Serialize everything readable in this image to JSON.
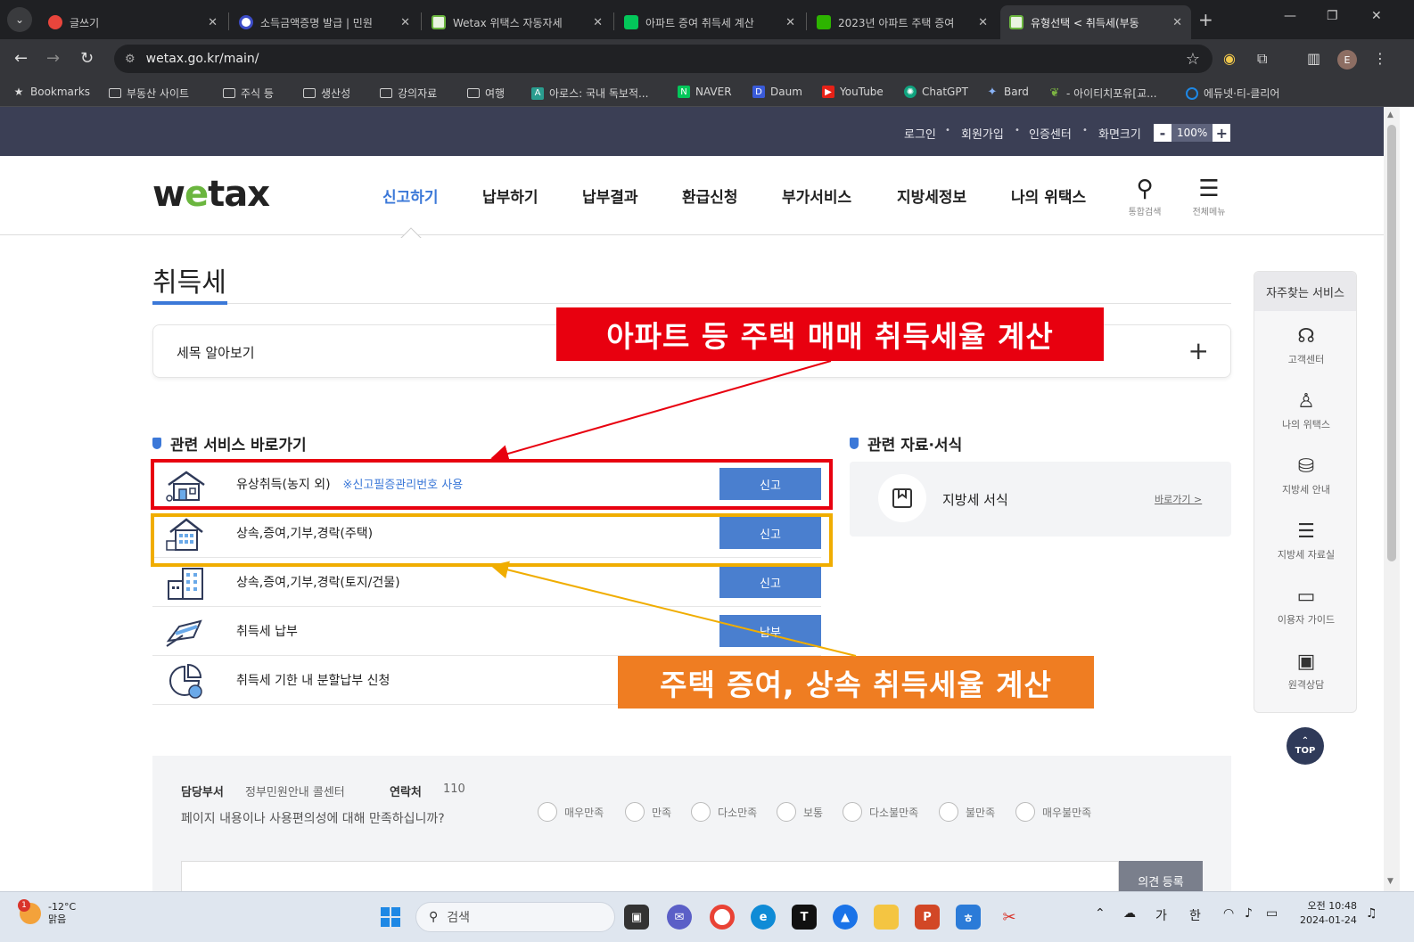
{
  "browser": {
    "tabs": [
      {
        "title": "글쓰기",
        "color": "#e8453c"
      },
      {
        "title": "소득금액증명 발급 | 민원",
        "color": "#3c4cc7"
      },
      {
        "title": "Wetax 위택스 자동자세",
        "color": "#6bb63f"
      },
      {
        "title": "아파트 증여 취득세 계산",
        "color": "#03c75a"
      },
      {
        "title": "2023년 아파트 주택 증여",
        "color": "#2db400"
      },
      {
        "title": "유형선택 < 취득세(부동",
        "color": "#6bb63f"
      }
    ],
    "url": "wetax.go.kr/main/",
    "bookmarks": [
      {
        "label": "Bookmarks",
        "kind": "star-icon"
      },
      {
        "label": "부동산 사이트",
        "kind": "folder-icon"
      },
      {
        "label": "주식 등",
        "kind": "folder-icon"
      },
      {
        "label": "생산성",
        "kind": "folder-icon"
      },
      {
        "label": "강의자료",
        "kind": "folder-icon"
      },
      {
        "label": "여행",
        "kind": "folder-icon"
      },
      {
        "label": "아로스: 국내 독보적...",
        "kind": "site-icon",
        "color": "#2a9d8f"
      },
      {
        "label": "NAVER",
        "kind": "site-icon",
        "color": "#03c75a"
      },
      {
        "label": "Daum",
        "kind": "site-icon",
        "color": "#3a5bd9"
      },
      {
        "label": "YouTube",
        "kind": "site-icon",
        "color": "#e62117"
      },
      {
        "label": "ChatGPT",
        "kind": "site-icon",
        "color": "#10a37f"
      },
      {
        "label": "Bard",
        "kind": "site-icon",
        "color": "#8ab4f8"
      },
      {
        "label": "- 아이티치포유[교...",
        "kind": "site-icon",
        "color": "#7cb342"
      },
      {
        "label": "에듀넷·티-클리어",
        "kind": "site-icon",
        "color": "#1e88e5"
      }
    ],
    "profile_initial": "E"
  },
  "util": {
    "login": "로그인",
    "signup": "회원가입",
    "cert": "인증센터",
    "screen": "화면크기",
    "zoom_minus": "-",
    "zoom_value": "100%",
    "zoom_plus": "+"
  },
  "gnb": {
    "logo_pre": "w",
    "logo_e": "e",
    "logo_post": "tax",
    "menu": [
      "신고하기",
      "납부하기",
      "납부결과",
      "환급신청",
      "부가서비스",
      "지방세정보",
      "나의 위택스"
    ],
    "active_menu": "신고하기",
    "search_label": "통합검색",
    "all_menu_label": "전체메뉴"
  },
  "page": {
    "title": "취득세",
    "accordion_label": "세목 알아보기",
    "accordion_toggle": "+"
  },
  "services": {
    "title": "관련 서비스 바로가기",
    "rows": [
      {
        "label": "유상취득(농지 외)",
        "note": "※신고필증관리번호 사용",
        "button": "신고"
      },
      {
        "label": "상속,증여,기부,경락(주택)",
        "note": "",
        "button": "신고"
      },
      {
        "label": "상속,증여,기부,경락(토지/건물)",
        "note": "",
        "button": "신고"
      },
      {
        "label": "취득세 납부",
        "note": "",
        "button": "납부"
      },
      {
        "label": "취득세 기한 내 분할납부 신청",
        "note": "",
        "button": ""
      }
    ]
  },
  "docs": {
    "title": "관련 자료·서식",
    "item_label": "지방세 서식",
    "item_link": "바로가기 >"
  },
  "quick": {
    "title": "자주찾는 서비스",
    "items": [
      {
        "label": "고객센터",
        "icon": "headset-icon",
        "glyph": "☊"
      },
      {
        "label": "나의 위택스",
        "icon": "user-icon",
        "glyph": "♙"
      },
      {
        "label": "지방세 안내",
        "icon": "coin-jar-icon",
        "glyph": "⛁"
      },
      {
        "label": "지방세 자료실",
        "icon": "list-icon",
        "glyph": "☰"
      },
      {
        "label": "이용자 가이드",
        "icon": "chat-icon",
        "glyph": "▭"
      },
      {
        "label": "원격상담",
        "icon": "monitor-icon",
        "glyph": "▣"
      }
    ],
    "top_button": "TOP"
  },
  "feedback": {
    "dept_label": "담당부서",
    "dept_value": "정부민원안내 콜센터",
    "contact_label": "연락처",
    "contact_value": "110",
    "question": "페이지 내용이나 사용편의성에 대해 만족하십니까?",
    "options": [
      "매우만족",
      "만족",
      "다소만족",
      "보통",
      "다소불만족",
      "불만족",
      "매우불만족"
    ],
    "submit": "의견 등록"
  },
  "annotations": {
    "callout_red": "아파트 등 주택 매매 취득세율 계산",
    "callout_orange": "주택 증여, 상속 취득세율 계산",
    "red_color": "#e8000f",
    "orange_color": "#f0ad00",
    "orange_fill": "#ef7d22"
  },
  "taskbar": {
    "temp": "-12°C",
    "weather": "맑음",
    "weather_badge": "1",
    "search_placeholder": "검색",
    "ime_1": "가",
    "ime_2": "한",
    "time": "오전 10:48",
    "date": "2024-01-24"
  }
}
